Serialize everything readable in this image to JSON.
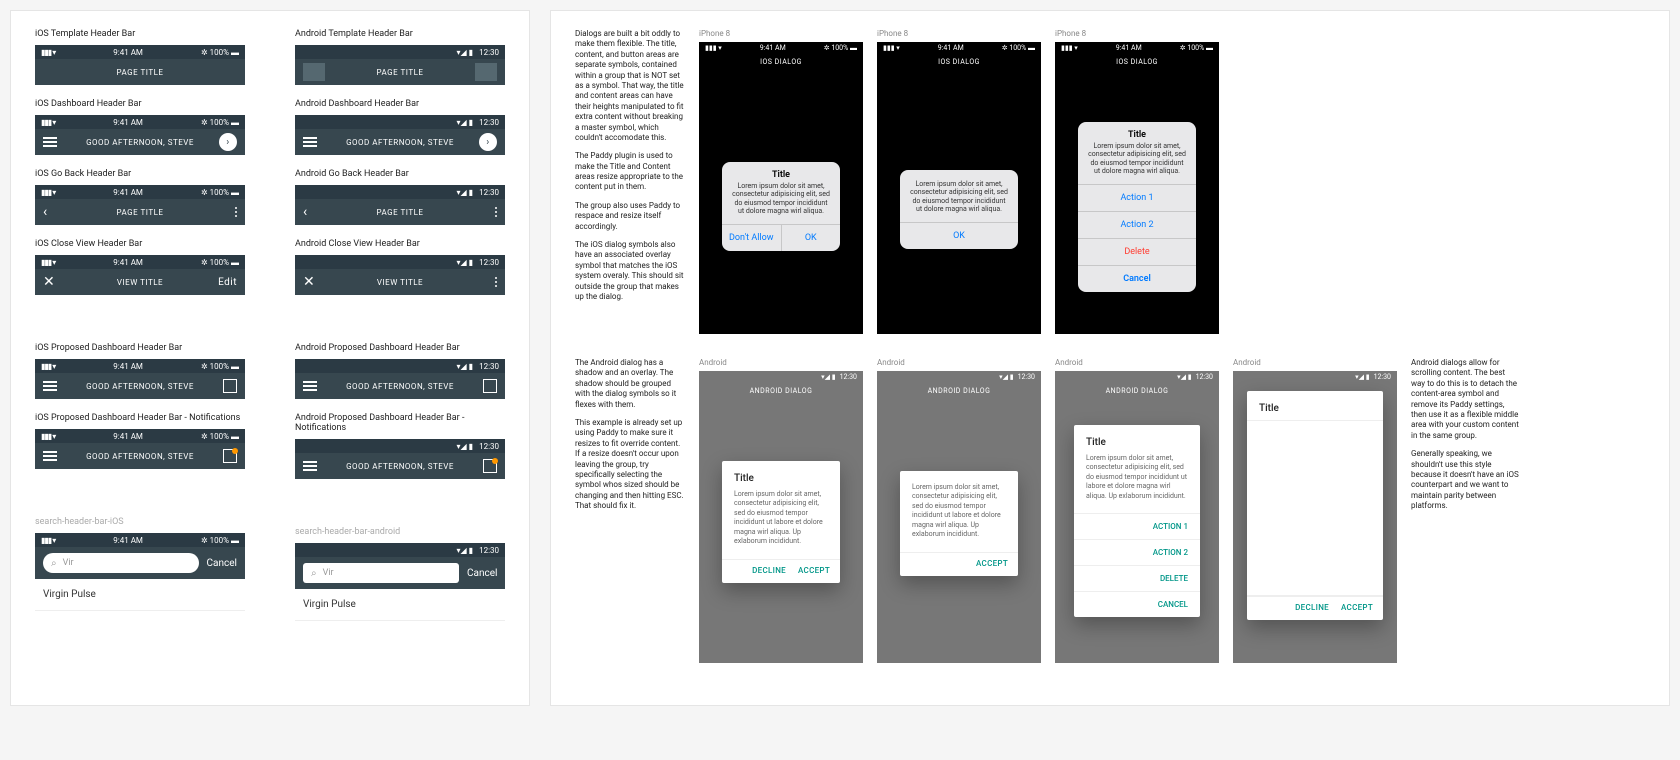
{
  "ios_time": "9:41 AM",
  "ios_batt": "100%",
  "android_time": "12:30",
  "labels": {
    "ios_template": "iOS Template Header Bar",
    "android_template": "Android Template Header Bar",
    "ios_dashboard": "iOS Dashboard Header Bar",
    "android_dashboard": "Android Dashboard Header Bar",
    "ios_goback": "iOS Go Back Header Bar",
    "android_goback": "Android Go Back Header Bar",
    "ios_closeview": "iOS Close View Header Bar",
    "android_closeview": "Android Close View Header Bar",
    "ios_proposed": "iOS Proposed Dashboard Header Bar",
    "android_proposed": "Android Proposed Dashboard Header Bar",
    "ios_proposed_notif": "iOS Proposed Dashboard Header Bar - Notifications",
    "android_proposed_notif": "Android Proposed Dashboard Header Bar - Notifications",
    "search_ios": "search-header-bar-iOS",
    "search_android": "search-header-bar-android"
  },
  "titles": {
    "page": "PAGE TITLE",
    "view": "VIEW TITLE",
    "greeting": "GOOD AFTERNOON, STEVE",
    "edit": "Edit",
    "cancel": "Cancel",
    "search_value": "Vir",
    "search_result": "Virgin Pulse"
  },
  "ios_device_label": "iPhone 8",
  "android_device_label": "Android",
  "ios_dialog_header": "IOS DIALOG",
  "android_dialog_header": "ANDROID DIALOG",
  "dialog_title": "Title",
  "dialog_body": "Lorem ipsum dolor sit amet, consectetur adipisicing elit, sed do eiusmod tempor incididunt ut dolore magna wirl aliqua.",
  "dialog_body_long": "Lorem ipsum dolor sit amet, consectetur adipisicing elit, sed do eiusmod tempor incididunt ut labore et dolore magna wirl aliqua. Up exlaborum incididunt.",
  "ios_actions": {
    "dont_allow": "Don't Allow",
    "ok": "OK",
    "action1": "Action 1",
    "action2": "Action 2",
    "delete": "Delete",
    "cancel": "Cancel"
  },
  "and_actions": {
    "decline": "DECLINE",
    "accept": "ACCEPT",
    "action1": "ACTION 1",
    "action2": "ACTION 2",
    "delete": "DELETE",
    "cancel": "CANCEL"
  },
  "notes": {
    "ios1": "Dialogs are built a bit oddly to make them flexible. The title, content, and button areas are separate symbols, contained within a group that is NOT set as a symbol. That way, the title and content areas can have their heights manipulated to fit extra content without breaking a master symbol, which couldn't accomodate this.",
    "ios2": "The Paddy plugin is used to make the Title and Content areas resize appropriate to the content put in them.",
    "ios3": "The group also uses Paddy to respace and resize itself accordingly.",
    "ios4": "The iOS dialog symbols also have an associated overlay symbol that matches the iOS system overaly. This should sit outside the group that makes up the dialog.",
    "and1": "The Android dialog has a shadow and an overlay. The shadow should be grouped with the dialog symbols so it flexes with them.",
    "and2": "This example is already set up using Paddy to make sure it resizes to fit override content. If a resize doesn't occur upon leaving the group, try specifically selecting the symbol whos sized should be changing and then hitting ESC. That should fix it.",
    "scroll1": "Android dialogs allow for scrolling content. The best way to do this is to detach the content-area symbol and remove its Paddy settings, then use it as a flexible middle area with your custom content in the same group.",
    "scroll2": "Generally speaking, we shouldn't use this style because it doesn't have an iOS counterpart and we want to maintain parity between platforms."
  }
}
